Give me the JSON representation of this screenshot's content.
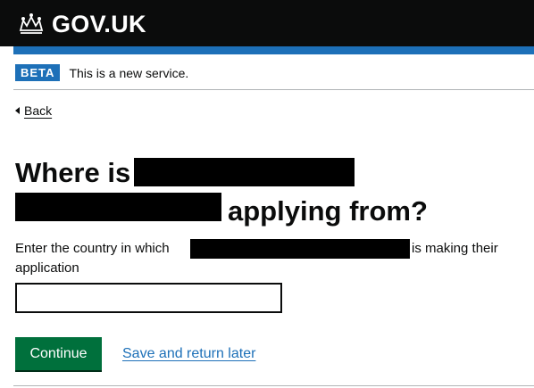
{
  "header": {
    "logo_text": "GOV.UK",
    "logo_icon": "crown-icon"
  },
  "phase_banner": {
    "tag": "BETA",
    "text": "This is a new service."
  },
  "back_link": {
    "label": "Back"
  },
  "question": {
    "heading_part1": "Where is",
    "heading_part2": "applying from?",
    "hint_part1": "Enter the country in which",
    "hint_part2": "is making their",
    "hint_part3": "application",
    "input_value": ""
  },
  "actions": {
    "continue_label": "Continue",
    "save_label": "Save and return later"
  },
  "colors": {
    "header_bg": "#0b0c0c",
    "brand_blue": "#1d70b8",
    "button_green": "#00703c",
    "link": "#1d70b8"
  }
}
